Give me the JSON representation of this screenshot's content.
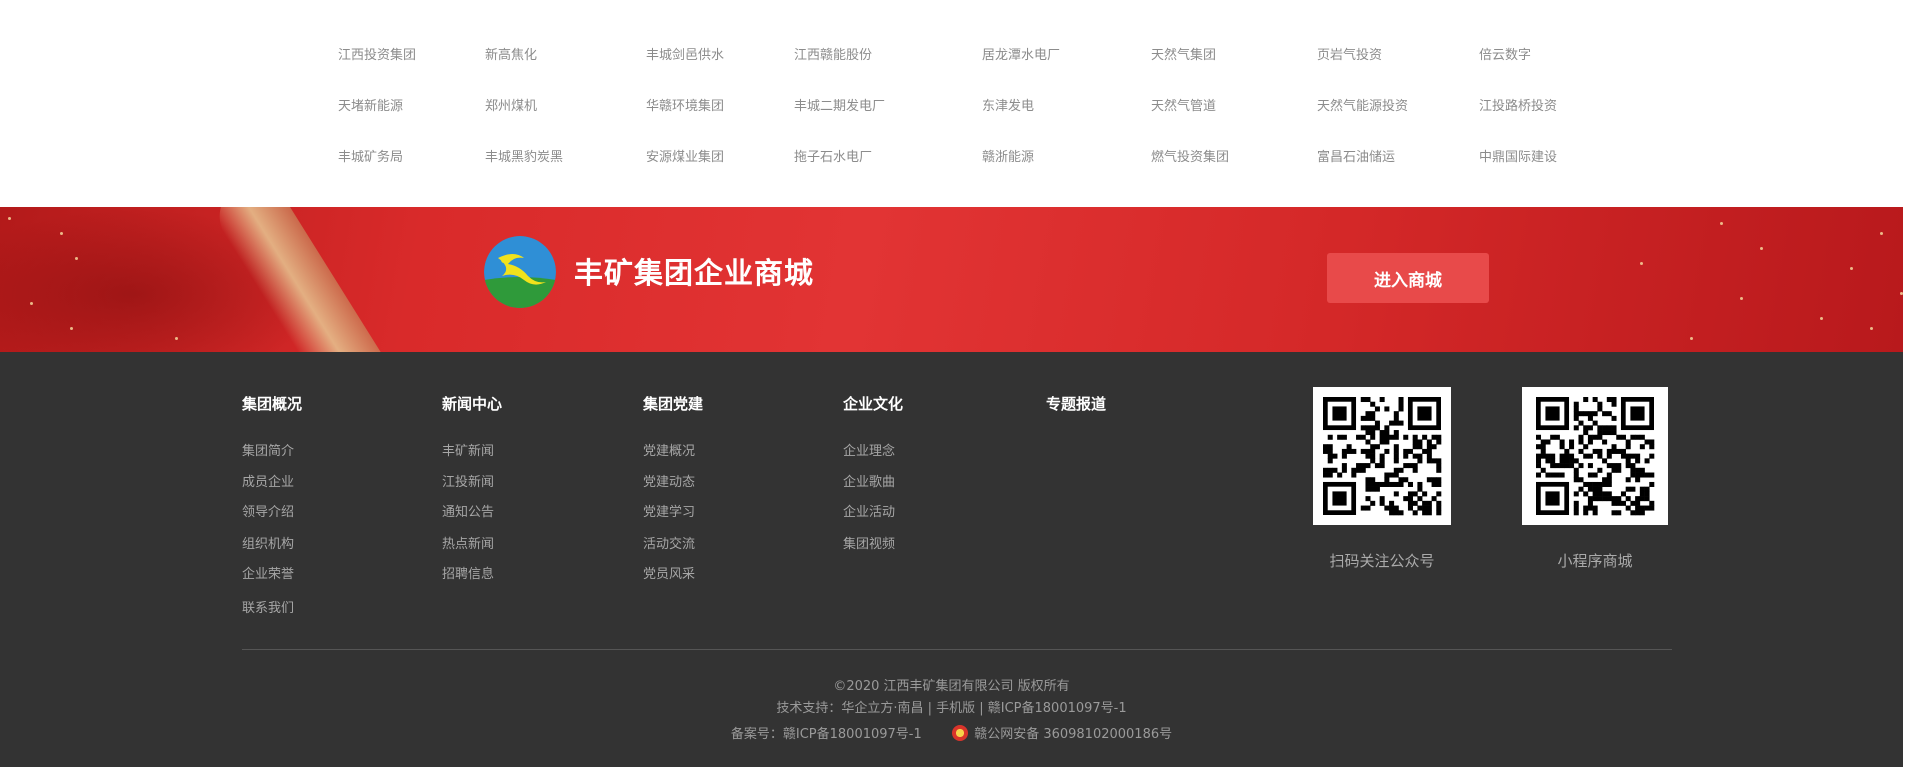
{
  "member_links": [
    [
      "江西投资集团",
      "新高焦化",
      "丰城剑邑供水",
      "江西赣能股份",
      "居龙潭水电厂",
      "天然气集团",
      "页岩气投资",
      "倍云数字"
    ],
    [
      "天堵新能源",
      "郑州煤机",
      "华赣环境集团",
      "丰城二期发电厂",
      "东津发电",
      "天然气管道",
      "天然气能源投资",
      "江投路桥投资"
    ],
    [
      "丰城矿务局",
      "丰城黑豹炭黑",
      "安源煤业集团",
      "拖子石水电厂",
      "赣浙能源",
      "燃气投资集团",
      "富昌石油储运",
      "中鼎国际建设"
    ]
  ],
  "banner": {
    "title": "丰矿集团企业商城",
    "button": "进入商城"
  },
  "footer": {
    "columns": [
      {
        "head": "集团概况",
        "links": [
          "集团简介",
          "成员企业",
          "领导介绍",
          "组织机构",
          "企业荣誉",
          "联系我们"
        ]
      },
      {
        "head": "新闻中心",
        "links": [
          "丰矿新闻",
          "江投新闻",
          "通知公告",
          "热点新闻",
          "招聘信息"
        ]
      },
      {
        "head": "集团党建",
        "links": [
          "党建概况",
          "党建动态",
          "党建学习",
          "活动交流",
          "党员风采"
        ]
      },
      {
        "head": "企业文化",
        "links": [
          "企业理念",
          "企业歌曲",
          "企业活动",
          "集团视频"
        ]
      },
      {
        "head": "专题报道",
        "links": []
      }
    ],
    "qr": [
      {
        "label": "扫码关注公众号",
        "icon": "qr-code-icon"
      },
      {
        "label": "小程序商城",
        "icon": "qr-code-icon"
      }
    ],
    "copyright": "©2020 江西丰矿集团有限公司 版权所有",
    "tech_support": "技术支持：华企立方·南昌 | 手机版 | 赣ICP备18001097号-1",
    "beian": "备案号：赣ICP备18001097号-1",
    "police": "赣公网安备 36098102000186号"
  },
  "colors": {
    "banner_red": "#d92a2a",
    "button_red": "#e84a4a",
    "footer_bg": "#333333"
  }
}
